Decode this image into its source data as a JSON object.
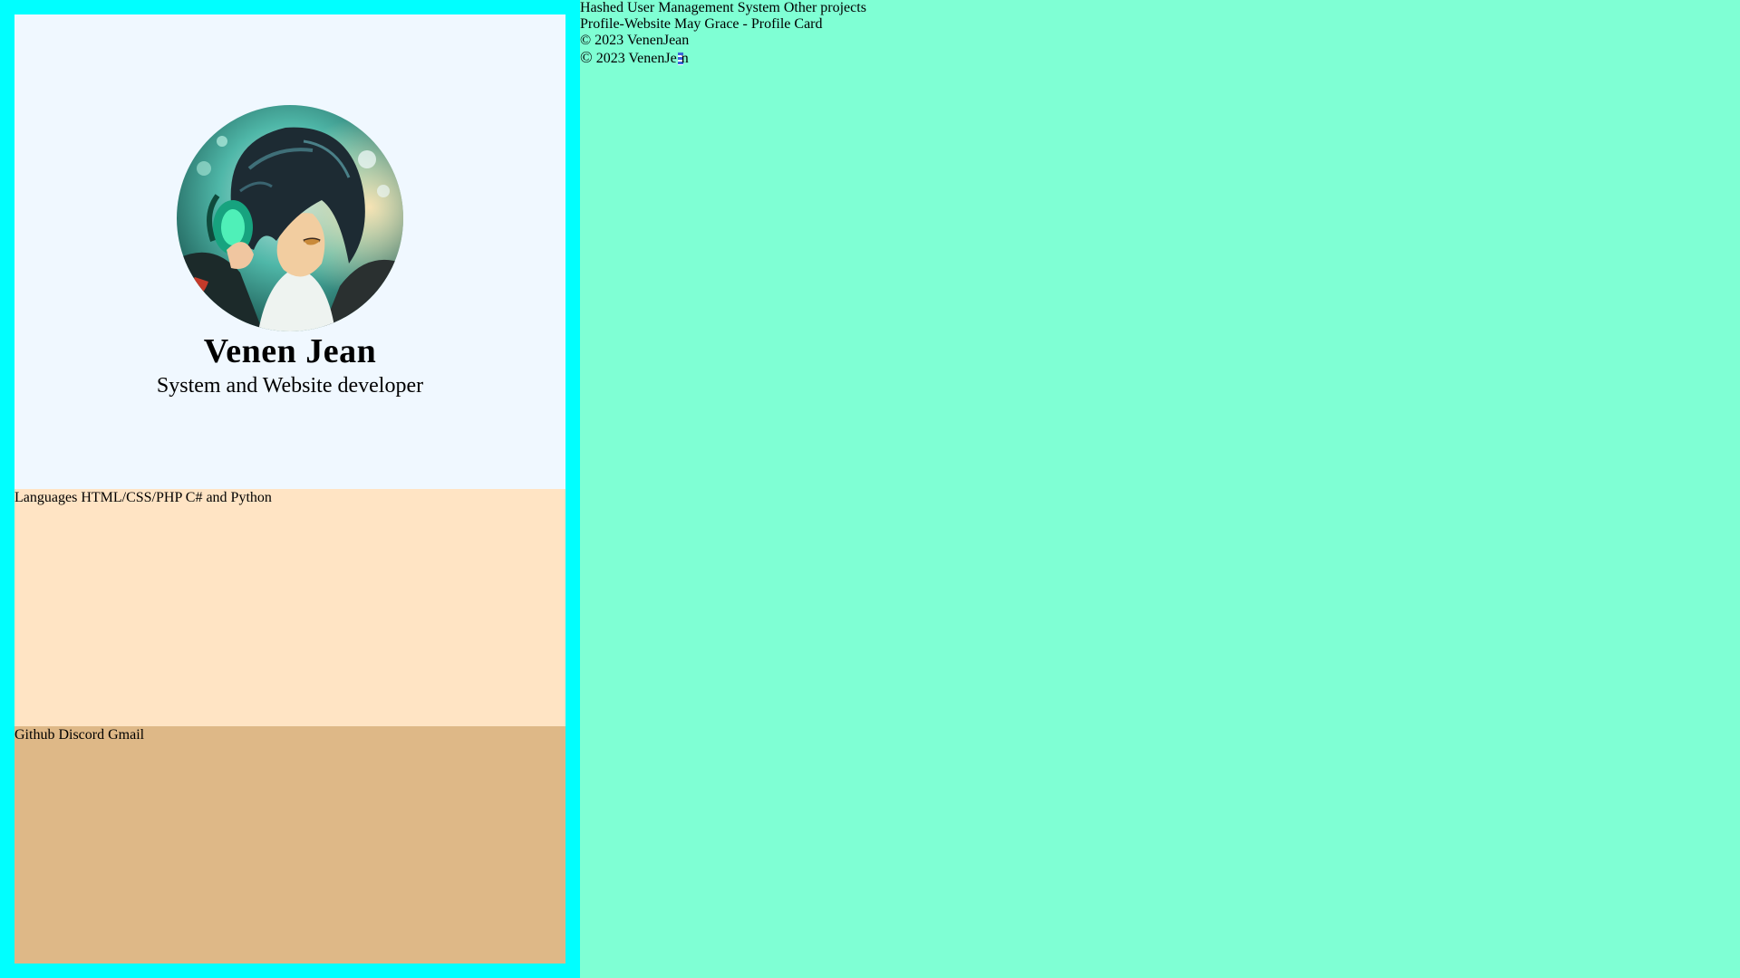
{
  "profile": {
    "name": "Venen Jean",
    "role": "System and Website developer"
  },
  "languages": {
    "label": "Languages",
    "items": [
      "HTML/CSS/PHP",
      "C# and Python"
    ]
  },
  "contacts": {
    "items": [
      "Github",
      "Discord",
      "Gmail"
    ]
  },
  "projects": {
    "items": [
      "Hashed User Management System",
      "Other projects"
    ],
    "items2": [
      "Profile-Website",
      "May Grace - Profile Card"
    ]
  },
  "footer": {
    "copyright": "© 2023 VenenJean",
    "copyright2_symbol": "©",
    "copyright2_before": " 2023 VenenJe",
    "copyright2_after": "n"
  },
  "colors": {
    "page_bg": "#7fffd4",
    "frame": "#00ffff",
    "profile_bg": "#f0f8ff",
    "languages_bg": "#ffe4c4",
    "contacts_bg": "#deb887"
  },
  "icons": {
    "avatar": "anime-character-avatar"
  }
}
